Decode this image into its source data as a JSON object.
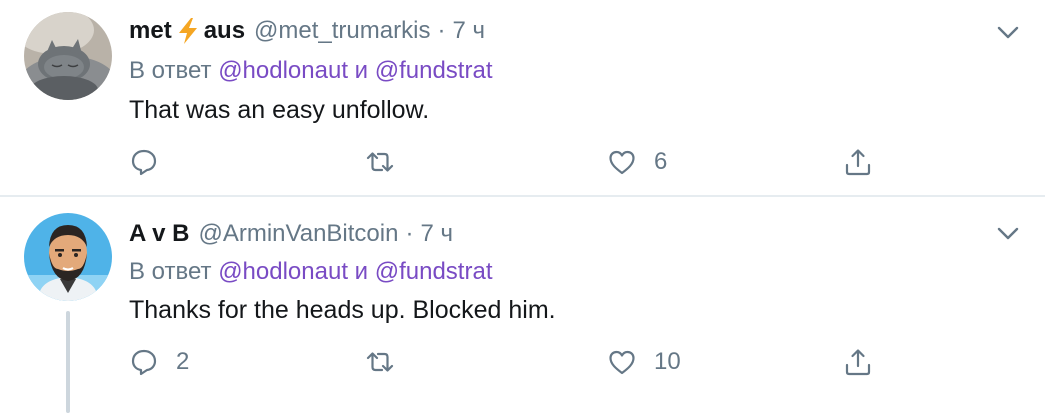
{
  "tweets": [
    {
      "name_part1": "met",
      "name_part2": "aus",
      "handle": "@met_trumarkis",
      "separator": "·",
      "time": "7 ч",
      "reply_prefix": "В ответ",
      "mention1": "@hodlonaut",
      "conj": "и",
      "mention2": "@fundstrat",
      "text": "That was an easy unfollow.",
      "reply_count": "",
      "retweet_count": "",
      "like_count": "6"
    },
    {
      "name": "A v B",
      "handle": "@ArminVanBitcoin",
      "separator": "·",
      "time": "7 ч",
      "reply_prefix": "В ответ",
      "mention1": "@hodlonaut",
      "conj": "и",
      "mention2": "@fundstrat",
      "text": "Thanks for the heads up. Blocked him.",
      "reply_count": "2",
      "retweet_count": "",
      "like_count": "10"
    }
  ],
  "icons": {
    "bolt": "lightning-bolt-icon",
    "reply": "reply-icon",
    "retweet": "retweet-icon",
    "like": "heart-icon",
    "share": "share-icon",
    "caret": "chevron-down-icon"
  },
  "colors": {
    "mention": "#794bc4",
    "secondary": "#657786",
    "bolt": "#f5a623"
  }
}
